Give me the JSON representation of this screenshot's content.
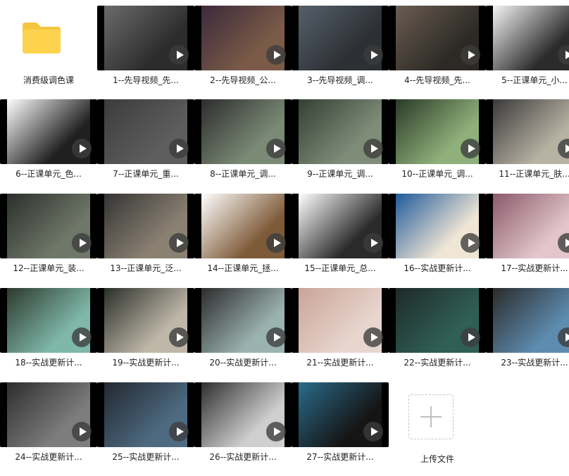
{
  "folder": {
    "label": "消费级调色课",
    "icon": "folder-icon",
    "color": "#FDD34D"
  },
  "videos": [
    {
      "label": "1--先导视频_先..."
    },
    {
      "label": "2--先导视频_公..."
    },
    {
      "label": "3--先导视频_调..."
    },
    {
      "label": "4--先导视频_先..."
    },
    {
      "label": "5--正课单元_小..."
    },
    {
      "label": "6--正课单元_色..."
    },
    {
      "label": "7--正课单元_重..."
    },
    {
      "label": "8--正课单元_调..."
    },
    {
      "label": "9--正课单元_调..."
    },
    {
      "label": "10--正课单元_调..."
    },
    {
      "label": "11--正课单元_肤..."
    },
    {
      "label": "12--正课单元_装..."
    },
    {
      "label": "13--正课单元_泛..."
    },
    {
      "label": "14--正课单元_拯..."
    },
    {
      "label": "15--正课单元_总..."
    },
    {
      "label": "16--实战更新计..."
    },
    {
      "label": "17--实战更新计..."
    },
    {
      "label": "18--实战更新计..."
    },
    {
      "label": "19--实战更新计..."
    },
    {
      "label": "20--实战更新计..."
    },
    {
      "label": "21--实战更新计..."
    },
    {
      "label": "22--实战更新计..."
    },
    {
      "label": "23--实战更新计..."
    },
    {
      "label": "24--实战更新计..."
    },
    {
      "label": "25--实战更新计..."
    },
    {
      "label": "26--实战更新计..."
    },
    {
      "label": "27--实战更新计..."
    }
  ],
  "upload": {
    "label": "上传文件",
    "icon": "plus-icon"
  }
}
